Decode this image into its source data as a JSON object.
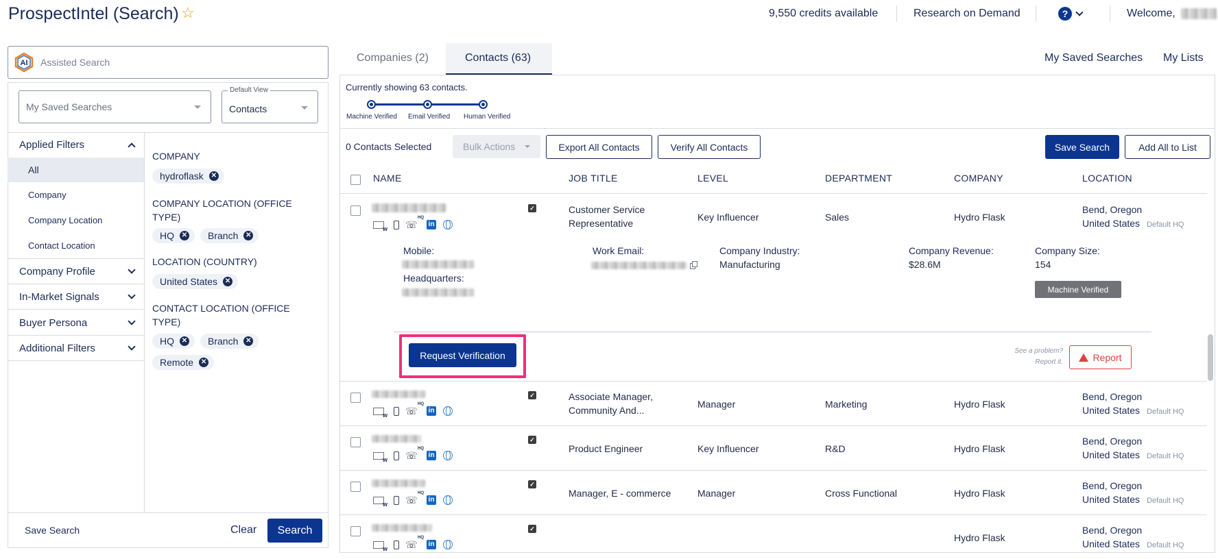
{
  "header": {
    "title": "ProspectIntel (Search)",
    "credits": "9,550 credits available",
    "research": "Research on Demand",
    "welcome": "Welcome,"
  },
  "sidebar": {
    "assisted_search_placeholder": "Assisted Search",
    "saved_searches_label": "My Saved Searches",
    "default_view_label": "Default View",
    "default_view_value": "Contacts",
    "applied_filters": "Applied Filters",
    "filter_items": [
      "All",
      "Company",
      "Company Location",
      "Contact Location"
    ],
    "sections": [
      "Company Profile",
      "In-Market Signals",
      "Buyer Persona",
      "Additional Filters"
    ],
    "filters": {
      "company_label": "COMPANY",
      "company_chips": [
        "hydroflask"
      ],
      "company_location_label": "COMPANY LOCATION (OFFICE TYPE)",
      "company_location_chips": [
        "HQ",
        "Branch"
      ],
      "location_country_label": "LOCATION (COUNTRY)",
      "location_country_chips": [
        "United States"
      ],
      "contact_location_label": "CONTACT LOCATION (OFFICE TYPE)",
      "contact_location_chips": [
        "HQ",
        "Branch",
        "Remote"
      ]
    },
    "save_search": "Save Search",
    "clear": "Clear",
    "search": "Search"
  },
  "tabs": [
    {
      "label": "Companies (2)"
    },
    {
      "label": "Contacts (63)"
    }
  ],
  "top_links": {
    "saved_searches": "My Saved Searches",
    "my_lists": "My Lists"
  },
  "verification": {
    "showing": "Currently showing 63 contacts.",
    "steps": [
      "Machine Verified",
      "Email Verified",
      "Human Verified"
    ]
  },
  "toolbar": {
    "selected": "0 Contacts Selected",
    "bulk_actions": "Bulk Actions",
    "export_all": "Export All Contacts",
    "verify_all": "Verify All Contacts",
    "save_search": "Save Search",
    "add_all": "Add All to List"
  },
  "table": {
    "headers": [
      "NAME",
      "JOB TITLE",
      "LEVEL",
      "DEPARTMENT",
      "COMPANY",
      "LOCATION"
    ],
    "expanded": {
      "job_title_1": "Customer Service",
      "job_title_2": "Representative",
      "level": "Key Influencer",
      "department": "Sales",
      "company": "Hydro Flask",
      "location_1": "Bend, Oregon",
      "location_2": "United States",
      "default_hq": "Default HQ",
      "mobile_label": "Mobile:",
      "headquarters_label": "Headquarters:",
      "work_email_label": "Work Email:",
      "industry_label": "Company Industry:",
      "industry_value": "Manufacturing",
      "revenue_label": "Company Revenue:",
      "revenue_value": "$28.6M",
      "size_label": "Company Size:",
      "size_value": "154",
      "verified_badge": "Machine Verified",
      "request_verification": "Request Verification",
      "see_problem_1": "See a problem?",
      "see_problem_2": "Report it.",
      "report": "Report"
    },
    "rows": [
      {
        "title_1": "Associate Manager,",
        "title_2": "Community And...",
        "level": "Manager",
        "department": "Marketing",
        "company": "Hydro Flask",
        "loc_1": "Bend, Oregon",
        "loc_2": "United States",
        "hq": "Default HQ"
      },
      {
        "title_1": "Product Engineer",
        "title_2": "",
        "level": "Key Influencer",
        "department": "R&D",
        "company": "Hydro Flask",
        "loc_1": "Bend, Oregon",
        "loc_2": "United States",
        "hq": "Default HQ"
      },
      {
        "title_1": "Manager, E - commerce",
        "title_2": "",
        "level": "Manager",
        "department": "Cross Functional",
        "company": "Hydro Flask",
        "loc_1": "Bend, Oregon",
        "loc_2": "United States",
        "hq": "Default HQ"
      },
      {
        "title_1": "",
        "title_2": "",
        "level": "",
        "department": "",
        "company": "Hydro Flask",
        "loc_1": "Bend, Oregon",
        "loc_2": "United States",
        "hq": "Default HQ"
      }
    ]
  }
}
